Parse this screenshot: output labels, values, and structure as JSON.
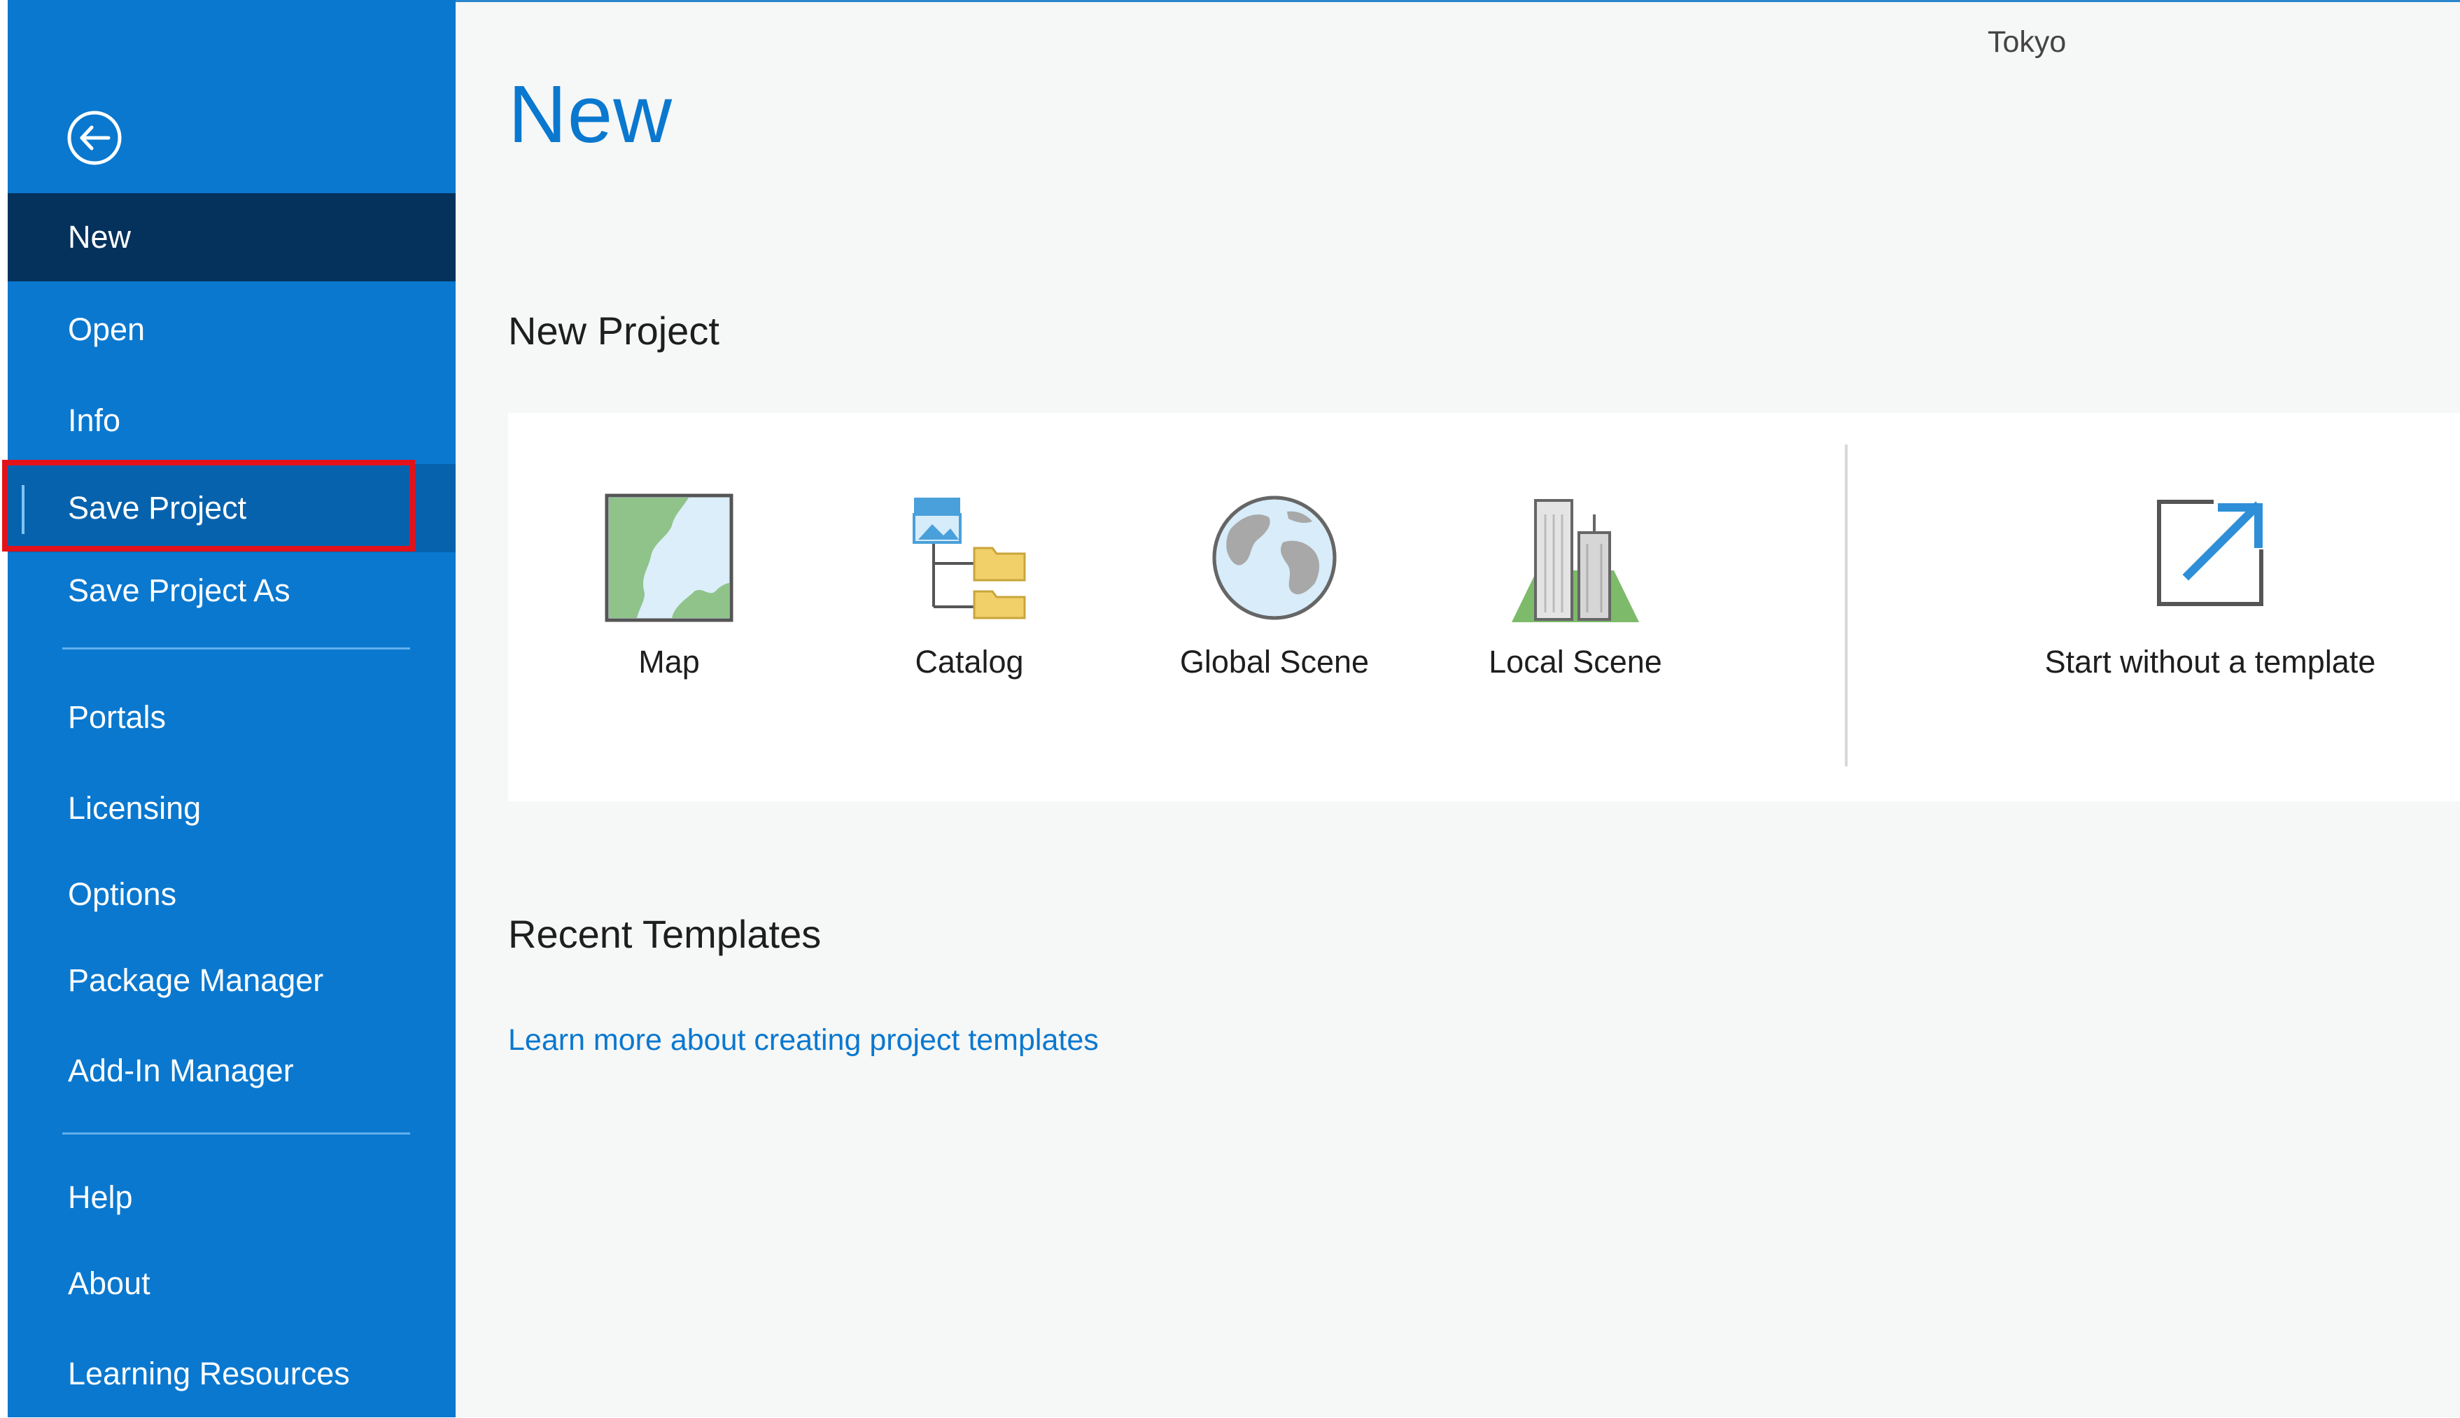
{
  "colors": {
    "sidebar": "#0a78cf",
    "sidebar_selected": "#04325c",
    "sidebar_hover": "#0662ad",
    "accent": "#0a78cf",
    "highlight_box": "#e3121a",
    "main_bg": "#f6f7f7"
  },
  "header": {
    "location": "Tokyo",
    "page_title": "New"
  },
  "sidebar": {
    "back_icon": "back-arrow-circle-icon",
    "items": [
      {
        "label": "New",
        "state": "selected"
      },
      {
        "label": "Open"
      },
      {
        "label": "Info"
      },
      {
        "label": "Save Project",
        "state": "hovered",
        "highlighted": true
      },
      {
        "label": "Save Project As"
      },
      {
        "label": "Portals"
      },
      {
        "label": "Licensing"
      },
      {
        "label": "Options"
      },
      {
        "label": "Package Manager"
      },
      {
        "label": "Add-In Manager"
      },
      {
        "label": "Help"
      },
      {
        "label": "About"
      },
      {
        "label": "Learning Resources"
      }
    ]
  },
  "new_project": {
    "heading": "New Project",
    "tiles": [
      {
        "label": "Map",
        "icon": "map-icon"
      },
      {
        "label": "Catalog",
        "icon": "catalog-icon"
      },
      {
        "label": "Global Scene",
        "icon": "globe-icon"
      },
      {
        "label": "Local Scene",
        "icon": "buildings-icon"
      },
      {
        "label": "Start without a template",
        "icon": "external-arrow-icon"
      }
    ]
  },
  "recent_templates": {
    "heading": "Recent Templates",
    "link": "Learn more about creating project templates"
  }
}
